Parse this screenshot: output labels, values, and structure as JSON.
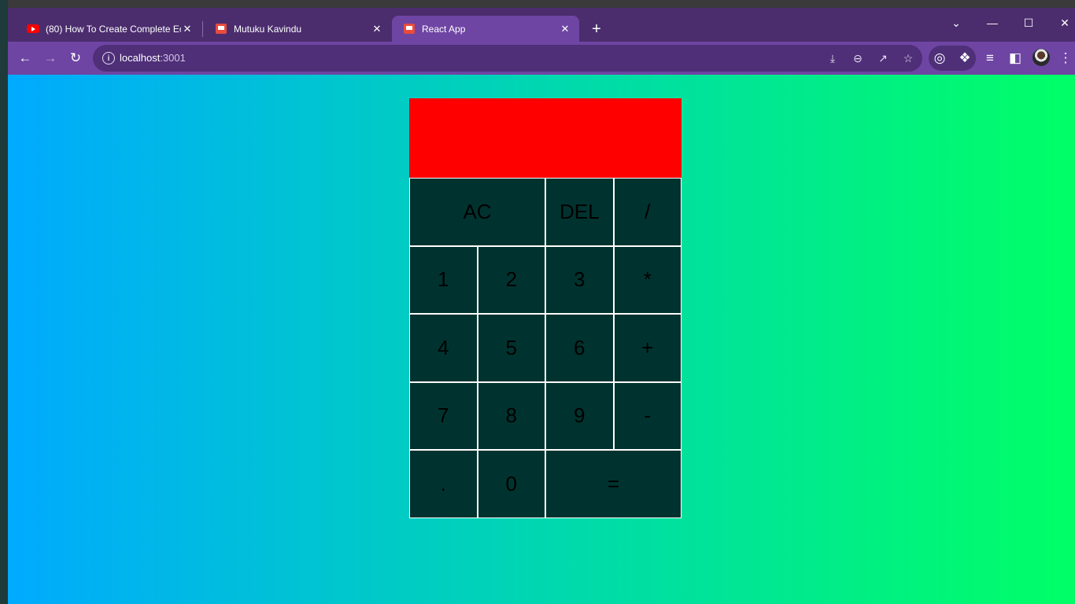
{
  "browser": {
    "tabs": [
      {
        "title": "(80) How To Create Complete Ec",
        "favicon": "youtube-icon",
        "active": false
      },
      {
        "title": "Mutuku Kavindu",
        "favicon": "react-app-icon",
        "active": false
      },
      {
        "title": "React App",
        "favicon": "react-app-icon",
        "active": true
      }
    ],
    "new_tab_label": "+",
    "close_glyph": "✕",
    "url_host": "localhost",
    "url_port": ":3001"
  },
  "calculator": {
    "display_value": "",
    "buttons": {
      "ac": "AC",
      "del": "DEL",
      "divide": "/",
      "one": "1",
      "two": "2",
      "three": "3",
      "multiply": "*",
      "four": "4",
      "five": "5",
      "six": "6",
      "add": "+",
      "seven": "7",
      "eight": "8",
      "nine": "9",
      "subtract": "-",
      "dot": ".",
      "zero": "0",
      "equals": "="
    }
  },
  "colors": {
    "display": "#ff0000",
    "button_bg": "#00332f",
    "gradient_start": "#00aaff",
    "gradient_end": "#00ff66",
    "browser_frame": "#6e45a3"
  }
}
